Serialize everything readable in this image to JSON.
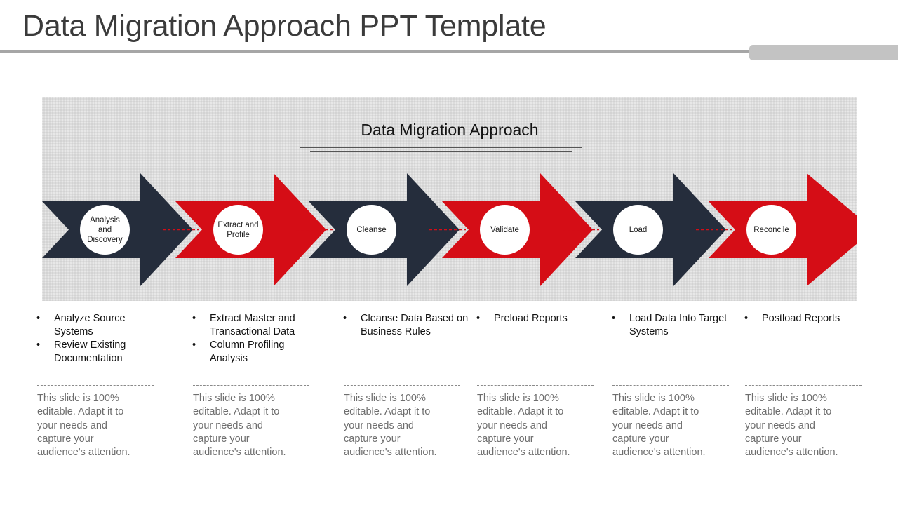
{
  "header": {
    "title": "Data Migration Approach PPT Template",
    "tab_label": ""
  },
  "slide": {
    "title": "Data Migration Approach",
    "panel_color": "#dcdcdc"
  },
  "colors": {
    "navy": "#252d3c",
    "red": "#d50d16",
    "connector": "#d50d16",
    "circle": "#ffffff",
    "note_text": "#6e6e6e",
    "title_text": "#3b3b3b"
  },
  "diagram": {
    "type": "process-chevron",
    "step_count": 6,
    "steps": [
      {
        "index": 1,
        "label": "Analysis and Discovery",
        "color": "#252d3c",
        "color_name": "navy"
      },
      {
        "index": 2,
        "label": "Extract and Profile",
        "color": "#d50d16",
        "color_name": "red"
      },
      {
        "index": 3,
        "label": "Cleanse",
        "color": "#252d3c",
        "color_name": "navy"
      },
      {
        "index": 4,
        "label": "Validate",
        "color": "#d50d16",
        "color_name": "red"
      },
      {
        "index": 5,
        "label": "Load",
        "color": "#252d3c",
        "color_name": "navy"
      },
      {
        "index": 6,
        "label": "Reconcile",
        "color": "#d50d16",
        "color_name": "red"
      }
    ]
  },
  "columns": [
    {
      "bullets": [
        "Analyze Source Systems",
        "Review Existing Documentation"
      ],
      "note": "This slide is 100% editable. Adapt it to your needs and capture your audience's attention."
    },
    {
      "bullets": [
        "Extract Master and Transactional Data",
        "Column Profiling Analysis"
      ],
      "note": "This slide is 100% editable. Adapt it to your needs and capture your audience's attention."
    },
    {
      "bullets": [
        "Cleanse Data Based on Business Rules"
      ],
      "note": "This slide is 100% editable. Adapt it to your needs and capture your audience's attention."
    },
    {
      "bullets": [
        "Preload Reports"
      ],
      "note": "This slide is 100% editable. Adapt it to your needs and capture your audience's attention."
    },
    {
      "bullets": [
        "Load Data Into Target Systems"
      ],
      "note": "This slide is 100% editable. Adapt it to your needs and capture your audience's attention."
    },
    {
      "bullets": [
        "Postload Reports"
      ],
      "note": "This slide is 100% editable. Adapt it to your needs and capture your audience's attention."
    }
  ],
  "bullet_glyph": "•"
}
